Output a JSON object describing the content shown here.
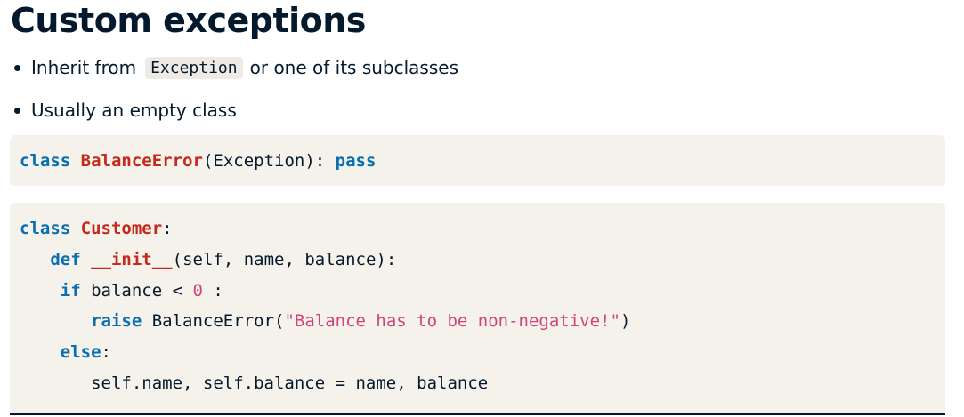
{
  "slide": {
    "title": "Custom exceptions",
    "bullets": [
      {
        "before": "Inherit from",
        "code": "Exception",
        "after": "or one of its subclasses"
      },
      {
        "text": "Usually an empty class"
      }
    ]
  },
  "code_block_1": {
    "line1": {
      "kw_class": "class",
      "class_name": "BalanceError",
      "args": "(Exception): ",
      "kw_pass": "pass"
    }
  },
  "code_block_2": {
    "line1": {
      "kw_class": "class",
      "class_name": "Customer",
      "colon": ":"
    },
    "line2": {
      "indent": "   ",
      "kw_def": "def",
      "func_name": "__init__",
      "params": "(self, name, balance):"
    },
    "line3": {
      "indent": "    ",
      "kw_if": "if",
      "cond_a": " balance < ",
      "num": "0",
      "cond_b": " :"
    },
    "line4": {
      "indent": "       ",
      "kw_raise": "raise",
      "call_a": " BalanceError(",
      "string": "\"Balance has to be non-negative!\"",
      "call_b": ")"
    },
    "line5": {
      "indent": "    ",
      "kw_else": "else",
      "colon": ":"
    },
    "line6": {
      "indent": "       ",
      "stmt": "self.name, self.balance = name, balance"
    }
  },
  "colors": {
    "keyword": "#0a6fb0",
    "class_name": "#c42a1c",
    "literal": "#d1437a",
    "text": "#05192d",
    "code_background": "#f5f2ec"
  }
}
